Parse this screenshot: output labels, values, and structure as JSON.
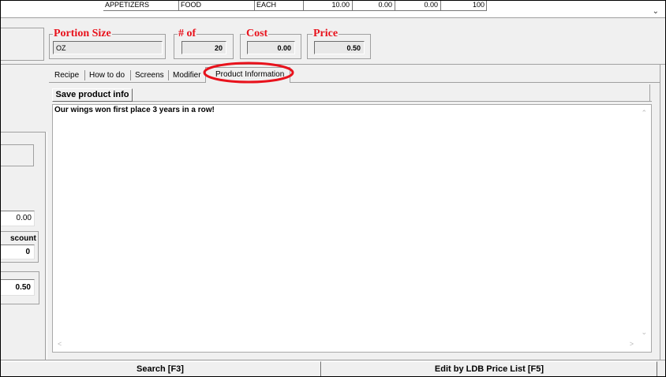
{
  "top_row": {
    "cells": [
      "APPETIZERS",
      "FOOD",
      "EACH",
      "10.00",
      "0.00",
      "0.00",
      "100"
    ]
  },
  "fields": {
    "portion_size": {
      "label": "Portion Size",
      "value": "OZ"
    },
    "num_of": {
      "label": "# of",
      "value": "20"
    },
    "cost": {
      "label": "Cost",
      "value": "0.00"
    },
    "price": {
      "label": "Price",
      "value": "0.50"
    }
  },
  "left_panel": {
    "value_1": "0.00",
    "discount_label": "scount",
    "discount_value": "0",
    "price_value": "0.50"
  },
  "tabs": [
    {
      "label": "Recipe"
    },
    {
      "label": "How to do"
    },
    {
      "label": "Screens"
    },
    {
      "label": "Modifier"
    },
    {
      "label": "Product Information",
      "active": true
    }
  ],
  "product_info": {
    "save_button": "Save product info",
    "text": "Our wings won first place 3 years in a row!"
  },
  "bottom_buttons": {
    "search": "Search [F3]",
    "edit_ldb": "Edit by LDB Price List [F5]"
  },
  "colors": {
    "label_red": "#e8121c",
    "highlight_circle": "#e8121c"
  }
}
